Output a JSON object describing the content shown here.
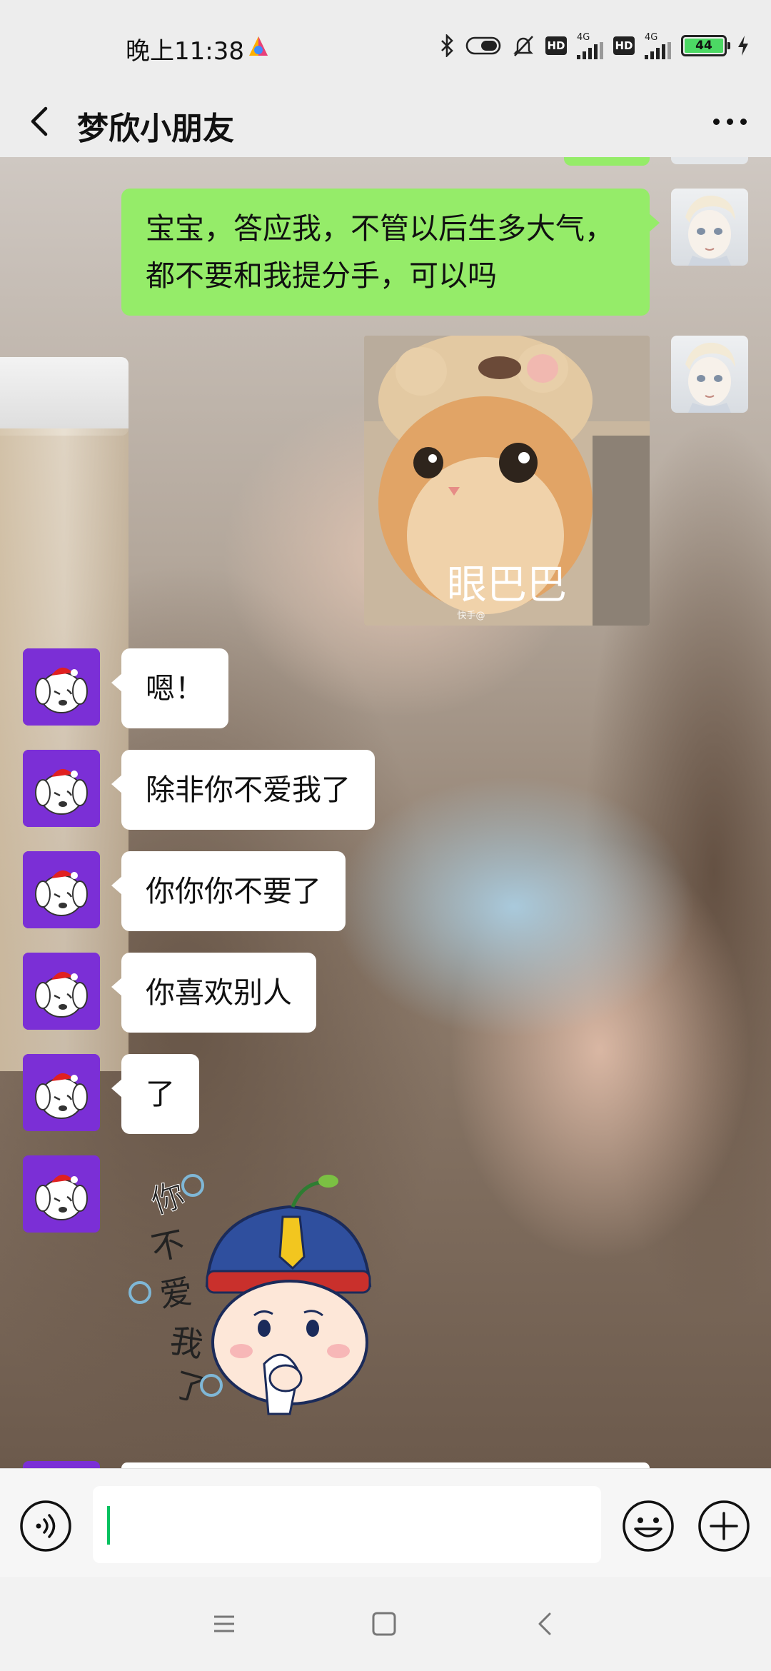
{
  "status_bar": {
    "time": "晚上11:38",
    "network_1": "4G",
    "network_2": "4G",
    "hd_1": "HD",
    "hd_2": "HD",
    "battery": "44",
    "icons": [
      "bluetooth-icon",
      "toggle-icon",
      "mute-icon",
      "hd-icon",
      "signal-icon",
      "hd-icon",
      "signal-icon",
      "battery-icon",
      "charging-icon"
    ]
  },
  "header": {
    "title": "梦欣小朋友",
    "back_icon": "chevron-left-icon",
    "more_icon": "more-dots-icon"
  },
  "messages": [
    {
      "sender": "self",
      "type": "text",
      "text_line1": "宝宝，答应我，不管以后生多大气，",
      "text_line2": "都不要和我提分手，可以吗"
    },
    {
      "sender": "self",
      "type": "image",
      "caption": "眼巴巴",
      "watermark": "快手@"
    },
    {
      "sender": "friend",
      "type": "text",
      "text": "嗯！"
    },
    {
      "sender": "friend",
      "type": "text",
      "text": "除非你不爱我了"
    },
    {
      "sender": "friend",
      "type": "text",
      "text": "你你你不要了"
    },
    {
      "sender": "friend",
      "type": "text",
      "text": "你喜欢别人"
    },
    {
      "sender": "friend",
      "type": "text",
      "text": "了"
    },
    {
      "sender": "friend",
      "type": "sticker",
      "text": "你不爱我了"
    }
  ],
  "input_bar": {
    "value": "",
    "icons": [
      "voice-icon",
      "emoji-icon",
      "plus-icon"
    ]
  },
  "system_nav": {
    "icons": [
      "menu-icon",
      "home-icon",
      "back-icon"
    ]
  },
  "colors": {
    "self_bubble": "#95ec69",
    "friend_bubble": "#ffffff",
    "friend_avatar_bg": "#7b2fd6",
    "caret": "#07c160"
  }
}
